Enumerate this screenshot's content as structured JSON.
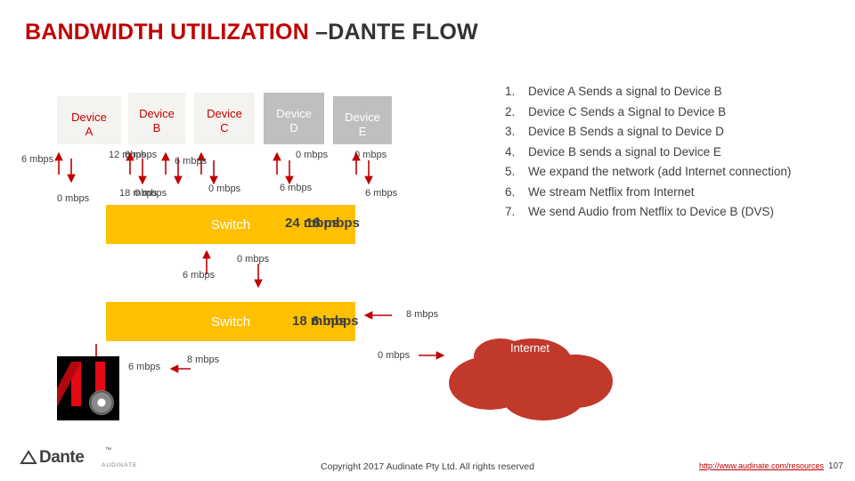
{
  "title": {
    "red": "BANDWIDTH UTILIZATION ",
    "dark": "–DANTE FLOW"
  },
  "devices": [
    {
      "name": "device-a",
      "label": "Device\nA",
      "style": "tan"
    },
    {
      "name": "device-b",
      "label": "Device\nB",
      "style": "tan"
    },
    {
      "name": "device-c",
      "label": "Device\nC",
      "style": "tan"
    },
    {
      "name": "device-d",
      "label": "Device\nD",
      "style": "grey"
    },
    {
      "name": "device-e",
      "label": "Device\nE",
      "style": "grey"
    }
  ],
  "device_labels": {
    "a_line1": "Device",
    "a_line2": "A",
    "b_line1": "Device",
    "b_line2": "B",
    "c_line1": "Device",
    "c_line2": "C",
    "d_line1": "Device",
    "d_line2": "D",
    "e_line1": "Device",
    "e_line2": "E"
  },
  "switches": {
    "top": "Switch",
    "bottom": "Switch"
  },
  "bandwidth_labels": {
    "a_up": "6 mbps",
    "a_down": "0 mbps",
    "b_up_left": "12 mbps",
    "b_up_right": "6 mbps",
    "b_down_left": "18 mbps",
    "b_down_right": "0 mbps",
    "c_up": "6 mbps",
    "c_down": "0 mbps",
    "d_up": "0 mbps",
    "d_down": "6 mbps",
    "e_up": "0 mbps",
    "e_down": "6 mbps",
    "switch_top_right_a": "24 mbps",
    "switch_top_right_b": "18 mbps",
    "switch_mid_up": "0 mbps",
    "switch_mid_down": "6 mbps",
    "switch_bottom_right_a": "18 mbps",
    "switch_bottom_right_b": "6 mbps",
    "internet_in": "8 mbps",
    "internet_out": "0 mbps",
    "netflix_left": "6 mbps",
    "netflix_right": "8 mbps"
  },
  "steps": [
    {
      "n": "1.",
      "t": "Device A Sends a signal to Device B"
    },
    {
      "n": "2.",
      "t": "Device C Sends a Signal to Device B"
    },
    {
      "n": "3.",
      "t": "Device B Sends a signal to Device D"
    },
    {
      "n": "4.",
      "t": "Device B sends a signal to Device E"
    },
    {
      "n": "5.",
      "t": "We expand the network (add Internet connection)"
    },
    {
      "n": "6.",
      "t": "We stream Netflix from Internet"
    },
    {
      "n": "7.",
      "t": "We send Audio from Netflix to Device B (DVS)"
    }
  ],
  "internet": {
    "label": "Internet"
  },
  "logo": {
    "word": "Dante",
    "tm": "™",
    "sub": "AUDINATE"
  },
  "footer": {
    "copyright": "Copyright 2017 Audinate Pty Ltd. All rights reserved",
    "link": "http://www.audinate.com/resources",
    "page": "107"
  },
  "colors": {
    "title_red": "#c00000",
    "title_dark": "#333333",
    "device_tan": "#f5f3ef",
    "device_grey": "#bfbfbf",
    "switch_yellow": "#ffc000",
    "cloud_red": "#c0392b",
    "arrow_red": "#c00000"
  }
}
